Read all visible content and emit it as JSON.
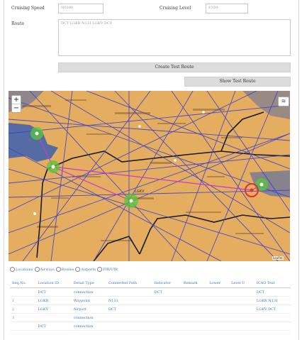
{
  "form": {
    "cruising_speed_label": "Cruising Speed",
    "cruising_speed_value": "N0280",
    "cruising_level_label": "Cruising Level",
    "cruising_level_value": "F350",
    "route_label": "Route",
    "route_value": "DCT LGKR N131 LGKV DCT"
  },
  "buttons": {
    "create_button": "Create Test Route",
    "show_button": "Show Test Route"
  },
  "map": {
    "zoom_in": "+",
    "zoom_out": "−",
    "layers_icon": "layers-icon",
    "attribution": "Leaflet",
    "place_label": "LGKV"
  },
  "colors": {
    "land": "#e5ad5f",
    "sea": "#3b5fb0",
    "airway": "#3a3fd0",
    "border": "#1a1a1a",
    "route": "#c83cc8",
    "waypoint_green": "#56c83c",
    "waypoint_red": "#e03030"
  },
  "filters": [
    {
      "label": "Locations"
    },
    {
      "label": "Airways"
    },
    {
      "label": "Routes"
    },
    {
      "label": "Airports"
    },
    {
      "label": "FIR/UIR"
    }
  ],
  "table": {
    "headers": [
      "Seq.No.",
      "Location ID",
      "Detail Type",
      "Connected Path",
      "Indicator",
      "Remark",
      "Lower",
      "Level U",
      "ICAO Text"
    ],
    "rows": [
      [
        "",
        "DCT",
        "connection",
        "",
        "DCT",
        "",
        "",
        "",
        "DCT"
      ],
      [
        "1",
        "LGKR",
        "Waypoint",
        "N131",
        "",
        "",
        "",
        "",
        "LGKR N131"
      ],
      [
        "2",
        "LGKV",
        "Airport",
        "DCT",
        "",
        "",
        "",
        "",
        "LGKV DCT"
      ],
      [
        "3",
        "",
        "connection",
        "",
        "",
        "",
        "",
        "",
        ""
      ],
      [
        "",
        "DCT",
        "connection",
        "",
        "",
        "",
        "",
        "",
        ""
      ]
    ]
  }
}
